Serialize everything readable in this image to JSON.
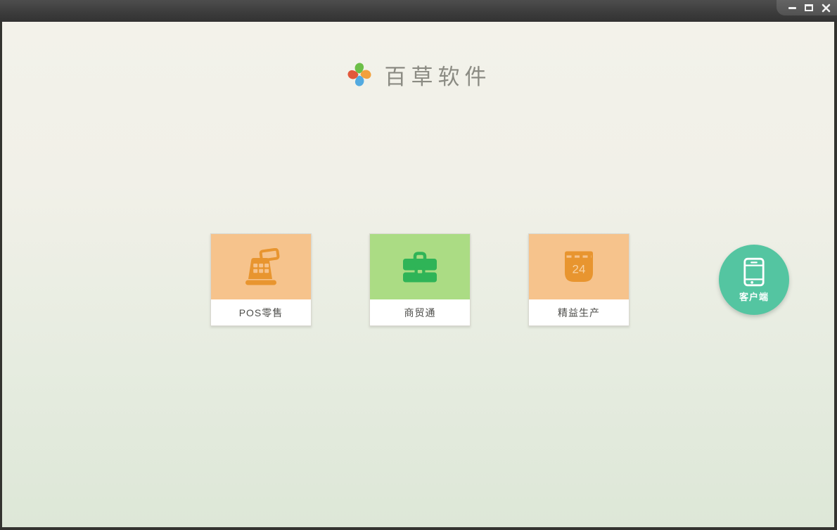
{
  "titlebar": {
    "controls": [
      {
        "name": "minimize",
        "icon": "minimize-icon"
      },
      {
        "name": "maximize",
        "icon": "maximize-icon"
      },
      {
        "name": "close",
        "icon": "close-icon"
      }
    ]
  },
  "brand": {
    "title": "百草软件",
    "logo_icon": "pinwheel-logo",
    "logo_petal_colors": {
      "top": "#6cbf48",
      "right": "#f2a03d",
      "bottom": "#53aae0",
      "left": "#e2593c"
    }
  },
  "products": [
    {
      "label": "POS零售",
      "icon": "cash-register-icon",
      "tile_color": "#f6c38c",
      "icon_color": "#e8952f"
    },
    {
      "label": "商贸通",
      "icon": "briefcase-icon",
      "tile_color": "#abdc84",
      "icon_color": "#2fb457"
    },
    {
      "label": "精益生产",
      "icon": "calendar-icon",
      "calendar_day": "24",
      "tile_color": "#f6c38c",
      "icon_color": "#e8952f"
    }
  ],
  "client_button": {
    "label": "客户端",
    "icon": "smartphone-icon",
    "color": "#54c5a1"
  },
  "colors": {
    "background_top": "#f3f2ea",
    "background_bottom": "#dde7d7",
    "titlebar": "#3d3d3d",
    "card_label_text": "#4d4d4a",
    "brand_text": "#8b8b83"
  }
}
